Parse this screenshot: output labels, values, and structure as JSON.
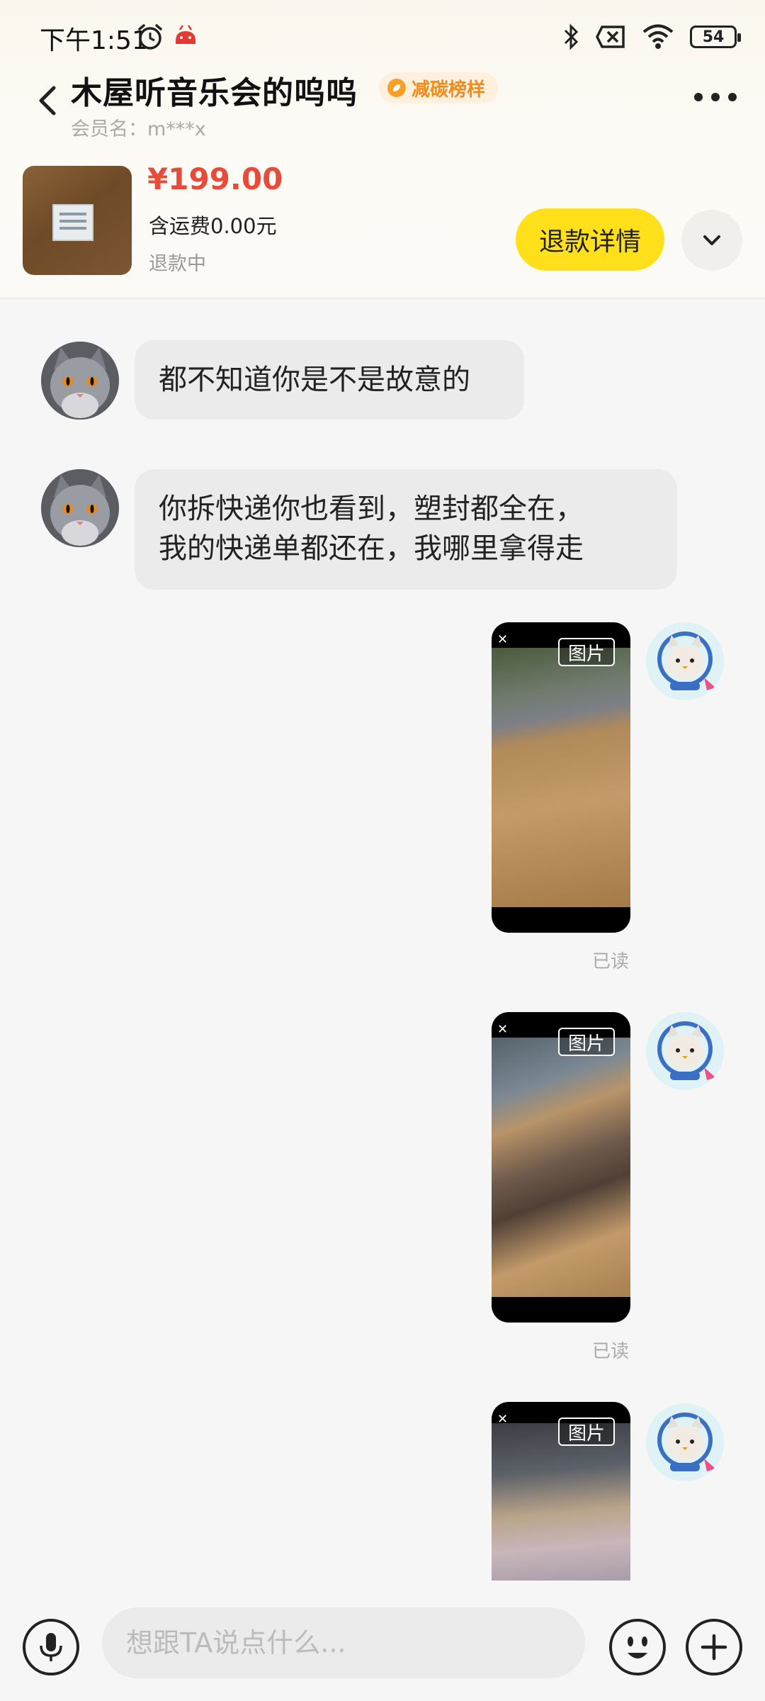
{
  "status_bar": {
    "time": "下午1:51",
    "battery": "54",
    "icons": [
      "alarm-icon",
      "app-notification-icon",
      "bluetooth-icon",
      "no-sim-icon",
      "wifi-icon",
      "battery-icon"
    ]
  },
  "header": {
    "title": "木屋听音乐会的呜呜",
    "badge": "减碳榜样",
    "member_label": "会员名：m***x"
  },
  "order": {
    "price": "¥199.00",
    "shipping": "含运费0.00元",
    "status": "退款中",
    "refund_button": "退款详情"
  },
  "messages": [
    {
      "sender": "other",
      "type": "text",
      "text": "都不知道你是不是故意的"
    },
    {
      "sender": "other",
      "type": "text",
      "lines": [
        "你拆快递你也看到，塑封都全在，",
        "我的快递单都还在，我哪里拿得走"
      ]
    },
    {
      "sender": "self",
      "type": "image",
      "tag": "图片",
      "read": "已读"
    },
    {
      "sender": "self",
      "type": "image",
      "tag": "图片",
      "read": "已读"
    },
    {
      "sender": "self",
      "type": "image",
      "tag": "图片"
    }
  ],
  "input": {
    "placeholder": "想跟TA说点什么..."
  },
  "colors": {
    "price": "#e84b3a",
    "refund_button": "#ffe01a",
    "badge_text": "#f08c1e"
  }
}
